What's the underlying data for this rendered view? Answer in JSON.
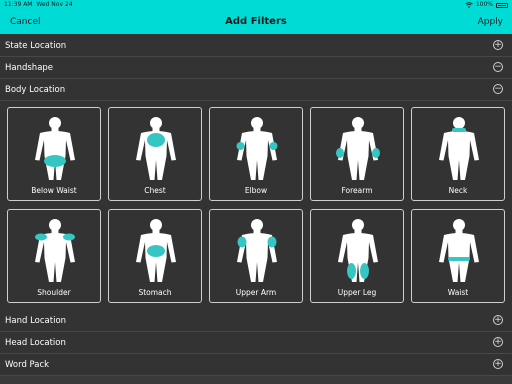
{
  "status_bar": {
    "time": "11:39 AM",
    "date": "Wed Nov 24",
    "battery": "100%"
  },
  "nav": {
    "cancel_label": "Cancel",
    "title": "Add Filters",
    "apply_label": "Apply"
  },
  "colors": {
    "accent": "#00dcd5",
    "background": "#333333",
    "highlight": "#35c6c3"
  },
  "sections_top": [
    {
      "label": "State Location",
      "toggle": "+",
      "expanded": false
    },
    {
      "label": "Handshape",
      "toggle": "−",
      "expanded": true
    },
    {
      "label": "Body Location",
      "toggle": "−",
      "expanded": true
    }
  ],
  "body_locations": [
    {
      "label": "Below Waist",
      "icon": "body-below-waist-icon"
    },
    {
      "label": "Chest",
      "icon": "body-chest-icon"
    },
    {
      "label": "Elbow",
      "icon": "body-elbow-icon"
    },
    {
      "label": "Forearm",
      "icon": "body-forearm-icon"
    },
    {
      "label": "Neck",
      "icon": "body-neck-icon"
    },
    {
      "label": "Shoulder",
      "icon": "body-shoulder-icon"
    },
    {
      "label": "Stomach",
      "icon": "body-stomach-icon"
    },
    {
      "label": "Upper Arm",
      "icon": "body-upper-arm-icon"
    },
    {
      "label": "Upper Leg",
      "icon": "body-upper-leg-icon"
    },
    {
      "label": "Waist",
      "icon": "body-waist-icon"
    }
  ],
  "sections_bottom": [
    {
      "label": "Hand Location",
      "toggle": "+"
    },
    {
      "label": "Head Location",
      "toggle": "+"
    },
    {
      "label": "Word Pack",
      "toggle": "+"
    }
  ]
}
